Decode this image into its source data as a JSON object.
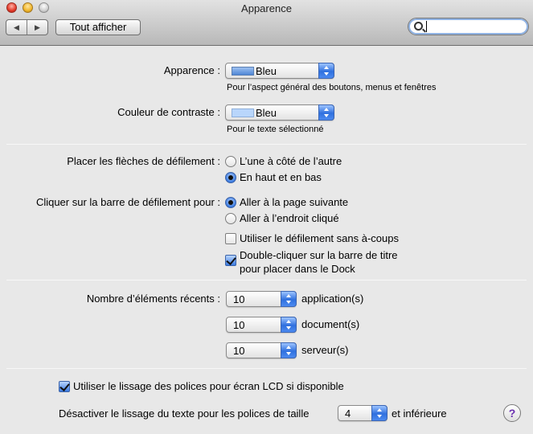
{
  "window": {
    "title": "Apparence"
  },
  "toolbar": {
    "back_glyph": "◀",
    "forward_glyph": "▶",
    "show_all_label": "Tout afficher",
    "search_value": "",
    "search_icon": "search-icon"
  },
  "appearance": {
    "label": "Apparence :",
    "value": "Bleu",
    "swatch_color": "#6f9ee0",
    "help": "Pour l’aspect général des boutons, menus et fenêtres"
  },
  "highlight": {
    "label": "Couleur de contraste :",
    "value": "Bleu",
    "swatch_color": "#b9d6fb",
    "help": "Pour le texte sélectionné"
  },
  "scroll_arrows": {
    "label": "Placer les flèches de défilement :",
    "options": [
      "L’une à côté de l’autre",
      "En haut et en bas"
    ],
    "selected_index": 1
  },
  "scroll_click": {
    "label": "Cliquer sur la barre de défilement pour :",
    "options": [
      "Aller à la page suivante",
      "Aller à l’endroit cliqué"
    ],
    "selected_index": 0
  },
  "smooth_scrolling": {
    "label": "Utiliser le défilement sans à-coups",
    "checked": false
  },
  "double_click": {
    "label_line1": "Double-cliquer sur la barre de titre",
    "label_line2": "pour placer dans le Dock",
    "checked": true
  },
  "recent_items": {
    "label": "Nombre d’éléments récents :",
    "rows": [
      {
        "value": "10",
        "unit": "application(s)"
      },
      {
        "value": "10",
        "unit": "document(s)"
      },
      {
        "value": "10",
        "unit": "serveur(s)"
      }
    ]
  },
  "lcd_smoothing": {
    "label": "Utiliser le lissage des polices pour écran LCD si disponible",
    "checked": true
  },
  "font_smoothing": {
    "label": "Désactiver le lissage du texte pour les polices de taille",
    "value": "4",
    "suffix": "et inférieure"
  },
  "help_button": {
    "label": "?"
  }
}
